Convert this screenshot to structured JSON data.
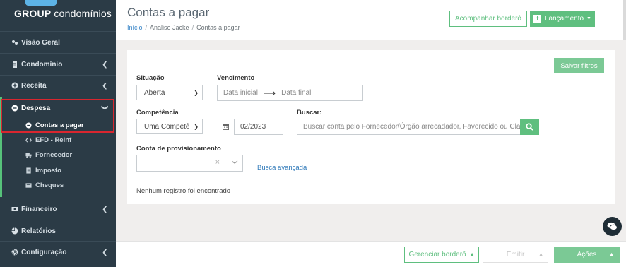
{
  "brand": {
    "bold": "GROUP",
    "rest": " condomínios"
  },
  "sidebar": {
    "items": [
      {
        "label": "Visão Geral",
        "icon": "dashboard-icon"
      },
      {
        "label": "Condomínio",
        "icon": "building-icon"
      },
      {
        "label": "Receita",
        "icon": "plus-circle-icon"
      },
      {
        "label": "Despesa",
        "icon": "minus-circle-icon"
      },
      {
        "label": "Financeiro",
        "icon": "bank-icon"
      },
      {
        "label": "Relatórios",
        "icon": "pie-chart-icon"
      },
      {
        "label": "Configuração",
        "icon": "gear-icon"
      }
    ],
    "despesa_sub": [
      {
        "label": "Contas a pagar",
        "icon": "minus-circle-icon"
      },
      {
        "label": "EFD - Reinf",
        "icon": "code-icon"
      },
      {
        "label": "Fornecedor",
        "icon": "truck-icon"
      },
      {
        "label": "Imposto",
        "icon": "file-icon"
      },
      {
        "label": "Cheques",
        "icon": "list-icon"
      }
    ]
  },
  "header": {
    "title": "Contas a pagar",
    "breadcrumb": [
      "Início",
      "Analise Jacke",
      "Contas a pagar"
    ],
    "btn_bordero": "Acompanhar borderô",
    "btn_lancamento": "Lançamento"
  },
  "filters": {
    "save_label": "Salvar filtros",
    "situacao_label": "Situação",
    "situacao_value": "Aberta",
    "vencimento_label": "Vencimento",
    "data_inicial": "Data inicial",
    "data_final": "Data final",
    "competencia_label": "Competência",
    "competencia_value": "Uma Competê",
    "competencia_date": "02/2023",
    "buscar_label": "Buscar:",
    "buscar_placeholder": "Buscar conta pelo Fornecedor/Órgão arrecadador, Favorecido ou Clas",
    "conta_label": "Conta de provisionamento",
    "busca_avancada": "Busca avançada",
    "empty": "Nenhum registro foi encontrado"
  },
  "footer": {
    "gerenciar": "Gerenciar borderô",
    "emitir": "Emitir",
    "acoes": "Ações"
  },
  "colors": {
    "accent": "#5fbf7f",
    "sidebar": "#2b3b46",
    "highlight": "#d9262f"
  }
}
